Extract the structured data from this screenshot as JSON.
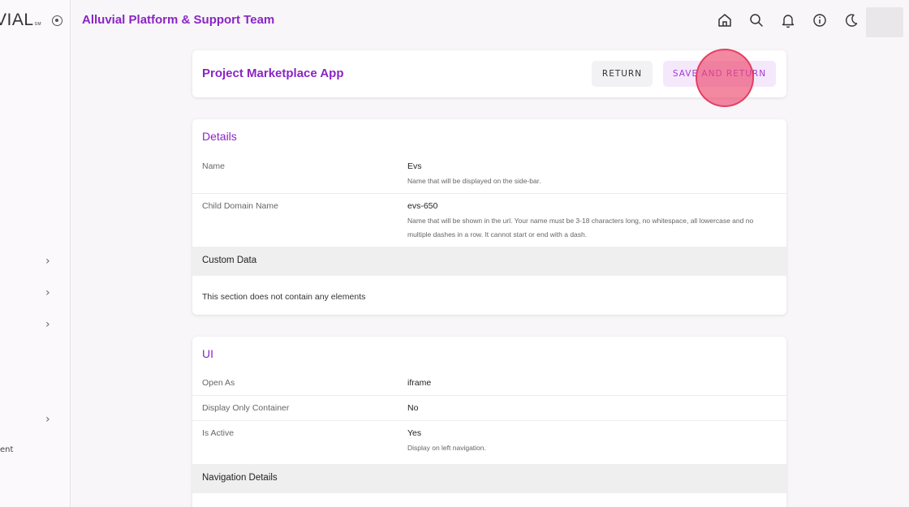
{
  "sidebar": {
    "logo_text": "VIAL",
    "logo_mark": "SM",
    "fragment_text": "ent",
    "chevron_icon": "chevron-right-icon"
  },
  "topbar": {
    "team_title": "Alluvial Platform & Support Team",
    "icons": [
      "home-icon",
      "search-icon",
      "bell-icon",
      "info-icon",
      "moon-icon"
    ]
  },
  "header": {
    "title": "Project Marketplace App",
    "return_label": "RETURN",
    "save_label": "SAVE AND RETURN"
  },
  "details": {
    "title": "Details",
    "name_label": "Name",
    "name_value": "Evs",
    "name_help": "Name that will be displayed on the side-bar.",
    "domain_label": "Child Domain Name",
    "domain_value": "evs-650",
    "domain_help": "Name that will be shown in the url. Your name must be 3-18 characters long, no whitespace, all lowercase and no multiple dashes in a row. It cannot start or end with a dash.",
    "custom_data_title": "Custom Data",
    "empty_message": "This section does not contain any elements"
  },
  "ui": {
    "title": "UI",
    "open_as_label": "Open As",
    "open_as_value": "iframe",
    "display_only_label": "Display Only Container",
    "display_only_value": "No",
    "is_active_label": "Is Active",
    "is_active_value": "Yes",
    "is_active_help": "Display on left navigation.",
    "nav_details_title": "Navigation Details"
  },
  "colors": {
    "accent": "#8a25c4",
    "save_bg": "#f5e8fb",
    "click_marker": "#ec486e"
  }
}
